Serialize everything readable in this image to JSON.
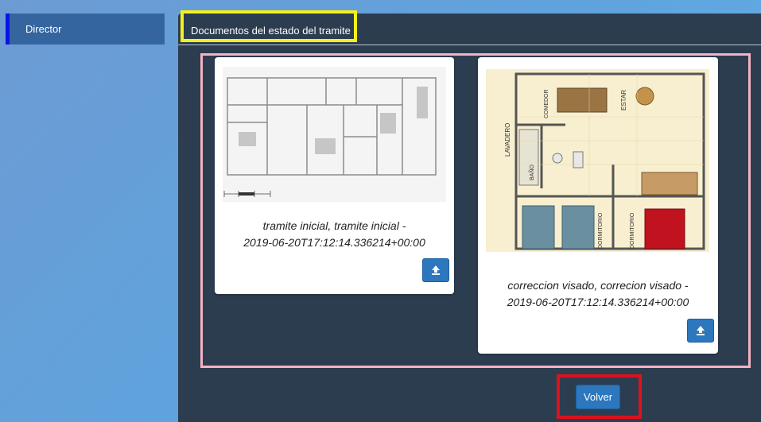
{
  "sidebar": {
    "items": [
      {
        "label": "Director",
        "active": true
      }
    ]
  },
  "panel": {
    "title": "Documentos del estado del tramite"
  },
  "documents": [
    {
      "caption_line1": "tramite inicial, tramite inicial -",
      "caption_line2": "2019-06-20T17:12:14.336214+00:00",
      "thumbnail": "floor-plan-drawing",
      "action_icon": "upload-icon"
    },
    {
      "caption_line1": "correccion visado, correcion visado -",
      "caption_line2": "2019-06-20T17:12:14.336214+00:00",
      "thumbnail": "colored-floor-plan",
      "action_icon": "upload-icon",
      "thumbnail_labels": [
        "LAVADERO",
        "COMEDOR",
        "ESTAR",
        "BAÑO",
        "DORMITORIO",
        "DORMITORIO"
      ]
    }
  ],
  "actions": {
    "back_label": "Volver"
  },
  "colors": {
    "panel_bg": "#2c3d50",
    "button_blue": "#2c77bd",
    "sidebar_active": "#34659f",
    "active_indicator": "#0a13e6",
    "highlight_yellow": "#f4f01f",
    "highlight_pink": "#f3b3c2",
    "highlight_red": "#e0101c"
  }
}
